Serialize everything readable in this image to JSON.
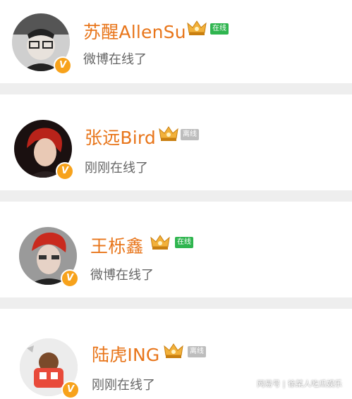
{
  "colors": {
    "name": "#e8751a",
    "status_text": "#666666",
    "online_tag": "#2fb54f",
    "offline_tag": "#bdbdbd",
    "verified_badge": "#f7a21b",
    "separator": "#eeeeee"
  },
  "users": [
    {
      "name": "苏醒AllenSu",
      "tag": "在线",
      "tag_state": "online",
      "status": "微博在线了",
      "badge_icon": "verified-v-icon",
      "crown_icon": "vip-crown-icon"
    },
    {
      "name": "张远Bird",
      "tag": "离线",
      "tag_state": "offline",
      "status": "刚刚在线了",
      "badge_icon": "verified-v-icon",
      "crown_icon": "vip-crown-icon"
    },
    {
      "name": "王栎鑫",
      "tag": "在线",
      "tag_state": "online",
      "status": "微博在线了",
      "badge_icon": "verified-v-icon",
      "crown_icon": "vip-crown-icon"
    },
    {
      "name": "陆虎ING",
      "tag": "离线",
      "tag_state": "offline",
      "status": "刚刚在线了",
      "badge_icon": "verified-v-icon",
      "crown_icon": "vip-crown-icon"
    }
  ],
  "watermark": "网易号 | 徐某人吃瓜娱乐"
}
